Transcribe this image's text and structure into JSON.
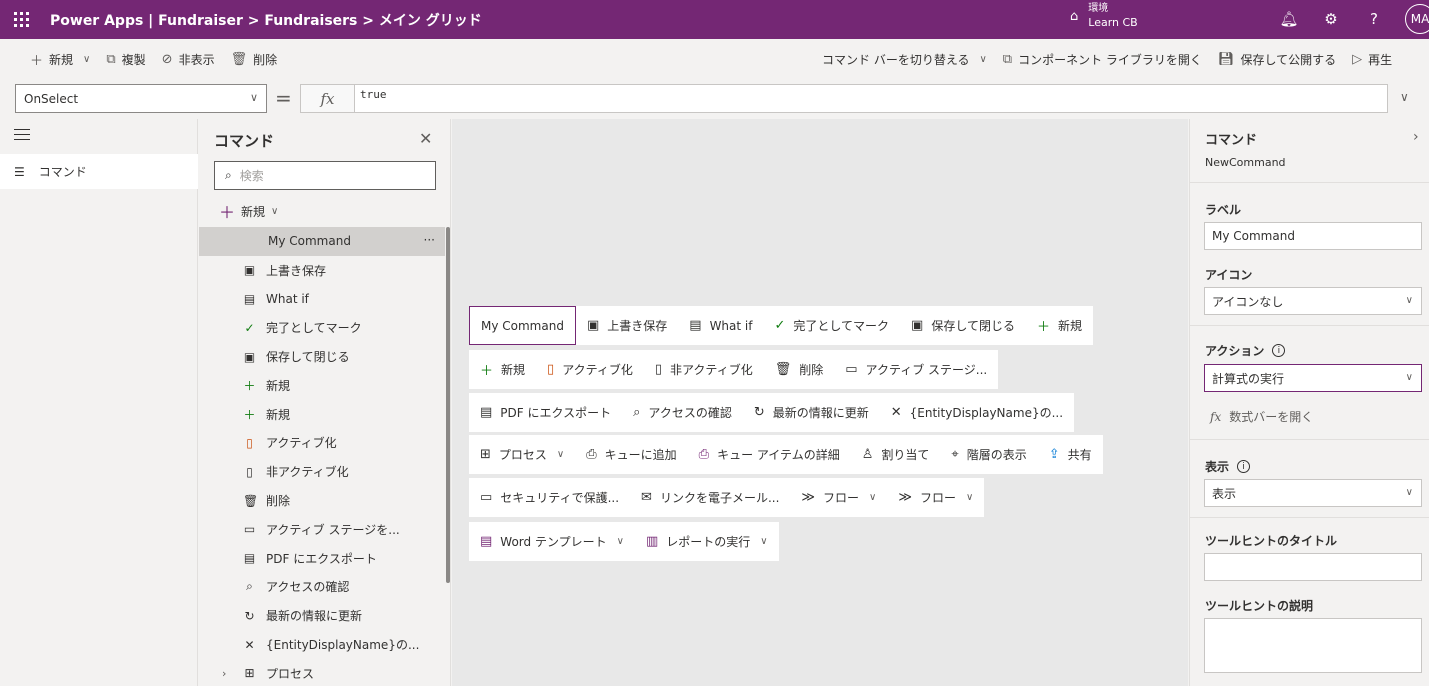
{
  "header": {
    "title": "Power Apps  |  Fundraiser > Fundraisers > メイン グリッド",
    "env_label": "環境",
    "env_name": "Learn CB",
    "avatar": "MA",
    "bg_color": "#742774"
  },
  "cmdbar": {
    "left": [
      {
        "icon": "plus-icon",
        "label": "新規"
      },
      {
        "icon": "copy-icon",
        "label": "複製"
      },
      {
        "icon": "hide-icon",
        "label": "非表示"
      },
      {
        "icon": "delete-icon",
        "label": "削除"
      }
    ],
    "right": [
      {
        "icon": "",
        "label": "コマンド バーを切り替える"
      },
      {
        "icon": "open-library-icon",
        "label": "コンポーネント ライブラリを開く"
      },
      {
        "icon": "save-icon",
        "label": "保存して公開する"
      },
      {
        "icon": "play-icon",
        "label": "再生"
      }
    ]
  },
  "formula": {
    "property": "OnSelect",
    "fx": "fx",
    "code": "true"
  },
  "leftnav": {
    "item": "コマンド"
  },
  "tree": {
    "title": "コマンド",
    "search_placeholder": "検索",
    "new_label": "新規",
    "items": [
      {
        "label": "My Command",
        "icon": ""
      },
      {
        "label": "上書き保存",
        "icon": "save-icon"
      },
      {
        "label": "What if",
        "icon": "calculator-icon"
      },
      {
        "label": "完了としてマーク",
        "icon": "check-icon"
      },
      {
        "label": "保存して閉じる",
        "icon": "save-close-icon"
      },
      {
        "label": "新規",
        "icon": "plus-icon"
      },
      {
        "label": "新規",
        "icon": "plus-icon"
      },
      {
        "label": "アクティブ化",
        "icon": "activate-icon"
      },
      {
        "label": "非アクティブ化",
        "icon": "deactivate-icon"
      },
      {
        "label": "削除",
        "icon": "delete-icon"
      },
      {
        "label": "アクティブ ステージを...",
        "icon": "stage-icon"
      },
      {
        "label": "PDF にエクスポート",
        "icon": "pdf-icon"
      },
      {
        "label": "アクセスの確認",
        "icon": "search-icon"
      },
      {
        "label": "最新の情報に更新",
        "icon": "refresh-icon"
      },
      {
        "label": "{EntityDisplayName}の...",
        "icon": "close-icon"
      },
      {
        "label": "プロセス",
        "icon": "process-icon"
      }
    ]
  },
  "canvas": {
    "rows": [
      [
        {
          "label": "My Command",
          "icon": "",
          "selected": true
        },
        {
          "label": "上書き保存",
          "icon": "save-icon"
        },
        {
          "label": "What if",
          "icon": "calculator-icon"
        },
        {
          "label": "完了としてマーク",
          "icon": "check-icon"
        },
        {
          "label": "保存して閉じる",
          "icon": "save-close-icon"
        },
        {
          "label": "新規",
          "icon": "plus-icon"
        }
      ],
      [
        {
          "label": "新規",
          "icon": "plus-icon"
        },
        {
          "label": "アクティブ化",
          "icon": "activate-icon"
        },
        {
          "label": "非アクティブ化",
          "icon": "deactivate-icon"
        },
        {
          "label": "削除",
          "icon": "delete-icon"
        },
        {
          "label": "アクティブ ステージ...",
          "icon": "stage-icon"
        }
      ],
      [
        {
          "label": "PDF にエクスポート",
          "icon": "pdf-icon"
        },
        {
          "label": "アクセスの確認",
          "icon": "search-icon"
        },
        {
          "label": "最新の情報に更新",
          "icon": "refresh-icon"
        },
        {
          "label": "{EntityDisplayName}の...",
          "icon": "close-icon"
        }
      ],
      [
        {
          "label": "プロセス",
          "icon": "process-icon",
          "chevron": true
        },
        {
          "label": "キューに追加",
          "icon": "queue-icon"
        },
        {
          "label": "キュー アイテムの詳細",
          "icon": "queue-item-icon"
        },
        {
          "label": "割り当て",
          "icon": "person-icon"
        },
        {
          "label": "階層の表示",
          "icon": "hierarchy-icon"
        },
        {
          "label": "共有",
          "icon": "share-icon"
        }
      ],
      [
        {
          "label": "セキュリティで保護...",
          "icon": "security-icon"
        },
        {
          "label": "リンクを電子メール...",
          "icon": "email-link-icon"
        },
        {
          "label": "フロー",
          "icon": "flow-icon",
          "chevron": true
        },
        {
          "label": "フロー",
          "icon": "flow-icon",
          "chevron": true
        }
      ],
      [
        {
          "label": "Word テンプレート",
          "icon": "word-icon",
          "chevron": true
        },
        {
          "label": "レポートの実行",
          "icon": "report-icon",
          "chevron": true
        }
      ]
    ]
  },
  "props": {
    "title": "コマンド",
    "subtitle": "NewCommand",
    "label_title": "ラベル",
    "label_value": "My Command",
    "icon_title": "アイコン",
    "icon_value": "アイコンなし",
    "action_title": "アクション",
    "action_value": "計算式の実行",
    "formula_link": "数式バーを開く",
    "display_title": "表示",
    "display_value": "表示",
    "tooltip_title_label": "ツールヒントのタイトル",
    "tooltip_desc_label": "ツールヒントの説明",
    "info": "i"
  }
}
